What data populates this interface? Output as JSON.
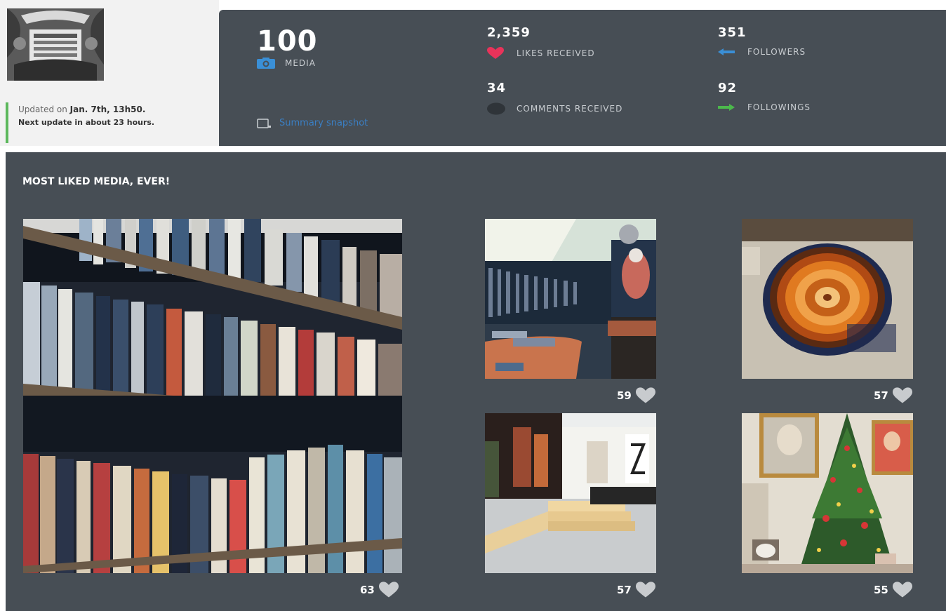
{
  "profile": {
    "updated_prefix": "Updated on",
    "updated_date": "Jan. 7th, 13h50.",
    "next_update": "Next update in about 23 hours."
  },
  "stats": {
    "media": {
      "value": "100",
      "label": "MEDIA",
      "icon": "camera-icon"
    },
    "likes": {
      "value": "2,359",
      "label": "LIKES RECEIVED",
      "icon": "heart-icon",
      "color": "#e8335a"
    },
    "comments": {
      "value": "34",
      "label": "COMMENTS RECEIVED",
      "icon": "comment-icon",
      "color": "#2f3439"
    },
    "followers": {
      "value": "351",
      "label": "FOLLOWERS",
      "icon": "arrow-left-icon",
      "color": "#3a8fd6"
    },
    "followings": {
      "value": "92",
      "label": "FOLLOWINGS",
      "icon": "arrow-right-icon",
      "color": "#4cb84c"
    },
    "snapshot_link": "Summary snapshot"
  },
  "most_liked": {
    "title": "MOST LIKED MEDIA, EVER!",
    "items": [
      {
        "likes": "63"
      },
      {
        "likes": "59"
      },
      {
        "likes": "57"
      },
      {
        "likes": "57"
      },
      {
        "likes": "55"
      }
    ]
  },
  "colors": {
    "panel_bg": "#474e55",
    "accent_blue": "#3a7fc4",
    "update_bar": "#5cb85c"
  }
}
